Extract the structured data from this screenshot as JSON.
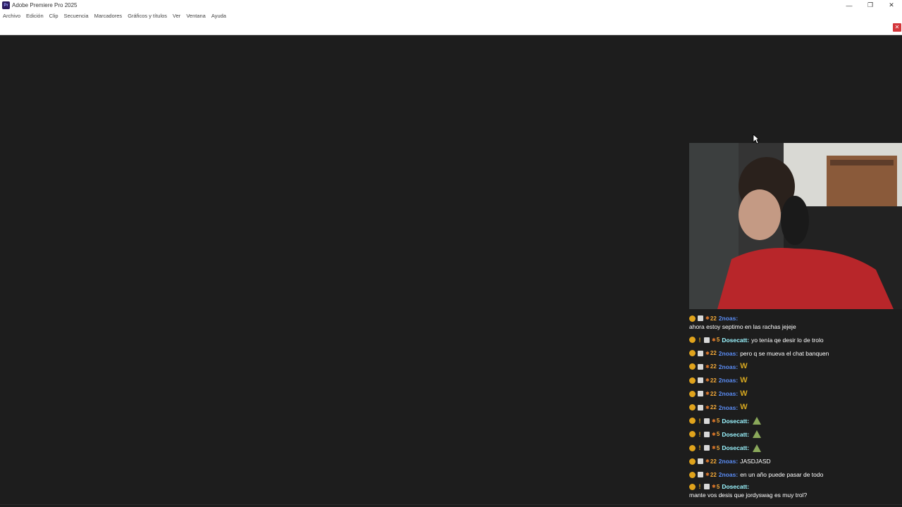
{
  "window": {
    "title": "Adobe Premiere Pro 2025",
    "app_icon_label": "Pr"
  },
  "menu": [
    "Archivo",
    "Edición",
    "Clip",
    "Secuencia",
    "Marcadores",
    "Gráficos y títulos",
    "Ver",
    "Ventana",
    "Ayuda"
  ],
  "chat": {
    "messages": [
      {
        "badges": [
          "gold",
          "box"
        ],
        "sub": "22",
        "user": "2noas",
        "user_class": "u-2noas",
        "text": "ahora estoy septimo en las rachas jejeje",
        "tall": true
      },
      {
        "badges": [
          "gold",
          "bang",
          "box"
        ],
        "sub": "5",
        "user": "Dosecatt",
        "user_class": "u-dosecatt",
        "text": "yo tenía qe desir lo de trolo"
      },
      {
        "badges": [
          "gold",
          "box"
        ],
        "sub": "22",
        "user": "2noas",
        "user_class": "u-2noas",
        "text": "pero q se mueva el chat banquen"
      },
      {
        "badges": [
          "gold",
          "box"
        ],
        "sub": "22",
        "user": "2noas",
        "user_class": "u-2noas",
        "emote": "W"
      },
      {
        "badges": [
          "gold",
          "box"
        ],
        "sub": "22",
        "user": "2noas",
        "user_class": "u-2noas",
        "emote": "W"
      },
      {
        "badges": [
          "gold",
          "box"
        ],
        "sub": "22",
        "user": "2noas",
        "user_class": "u-2noas",
        "emote": "W"
      },
      {
        "badges": [
          "gold",
          "box"
        ],
        "sub": "22",
        "user": "2noas",
        "user_class": "u-2noas",
        "emote": "W"
      },
      {
        "badges": [
          "gold",
          "bang",
          "box"
        ],
        "sub": "5",
        "user": "Dosecatt",
        "user_class": "u-dosecatt",
        "emote": "tree"
      },
      {
        "badges": [
          "gold",
          "bang",
          "box"
        ],
        "sub": "5",
        "user": "Dosecatt",
        "user_class": "u-dosecatt",
        "emote": "tree"
      },
      {
        "badges": [
          "gold",
          "bang",
          "box"
        ],
        "sub": "5",
        "user": "Dosecatt",
        "user_class": "u-dosecatt",
        "emote": "tree"
      },
      {
        "badges": [
          "gold",
          "box"
        ],
        "sub": "22",
        "user": "2noas",
        "user_class": "u-2noas",
        "text": "JASDJASD"
      },
      {
        "badges": [
          "gold",
          "box"
        ],
        "sub": "22",
        "user": "2noas",
        "user_class": "u-2noas",
        "text": "en un año puede pasar de todo"
      },
      {
        "badges": [
          "gold",
          "bang",
          "box"
        ],
        "sub": "5",
        "user": "Dosecatt",
        "user_class": "u-dosecatt",
        "text": "mante vos desis que jordyswag es muy trol?",
        "tall": true
      }
    ]
  },
  "colors": {
    "workspace_bg": "#1d1d1d",
    "user_2noas": "#5b8df5",
    "user_dosecatt": "#9bf5ff",
    "badge_gold": "#e0a31c",
    "sub_number": "#f2a93a",
    "close_red": "#d4363b"
  },
  "icons": {
    "minimize": "minimize-icon",
    "restore": "restore-icon",
    "close": "close-icon",
    "panel_close": "panel-close-icon",
    "cursor": "mouse-pointer-icon",
    "emote_w": "w-emote-icon",
    "emote_tree": "tree-emote-icon"
  }
}
